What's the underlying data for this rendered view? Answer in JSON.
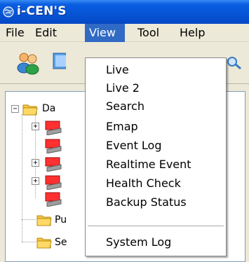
{
  "window": {
    "title": "i-CEN'S",
    "icon": "globe-icon",
    "title_bar_color": "#0654d6"
  },
  "menubar": {
    "items": [
      {
        "label": "File"
      },
      {
        "label": "Edit"
      },
      {
        "label": "View"
      },
      {
        "label": "Tool"
      },
      {
        "label": "Help"
      }
    ],
    "active": "View",
    "highlight_color": "#316ac5"
  },
  "toolbar": {
    "buttons": [
      {
        "icon": "users-icon"
      },
      {
        "icon": "monitor-icon"
      },
      {
        "icon": "search-icon"
      }
    ]
  },
  "tree": {
    "nodes": [
      {
        "label": "Da",
        "icon": "folder-icon",
        "expanded": true
      },
      {
        "label": "",
        "icon": "device-icon",
        "expander": "+"
      },
      {
        "label": "",
        "icon": "device-icon",
        "expander": "+"
      },
      {
        "label": "",
        "icon": "device-icon",
        "expander": "+"
      },
      {
        "label": "",
        "icon": "device-icon"
      },
      {
        "label": "Pu",
        "icon": "folder-icon"
      },
      {
        "label": "Se",
        "icon": "folder-icon"
      }
    ]
  },
  "view_menu": {
    "items": [
      {
        "label": "Live"
      },
      {
        "label": "Live 2"
      },
      {
        "label": "Search"
      },
      {
        "label": "Emap"
      },
      {
        "label": "Event Log"
      },
      {
        "label": "Realtime Event"
      },
      {
        "label": "Health Check"
      },
      {
        "label": "Backup Status"
      },
      {
        "label": "System Log"
      }
    ]
  }
}
